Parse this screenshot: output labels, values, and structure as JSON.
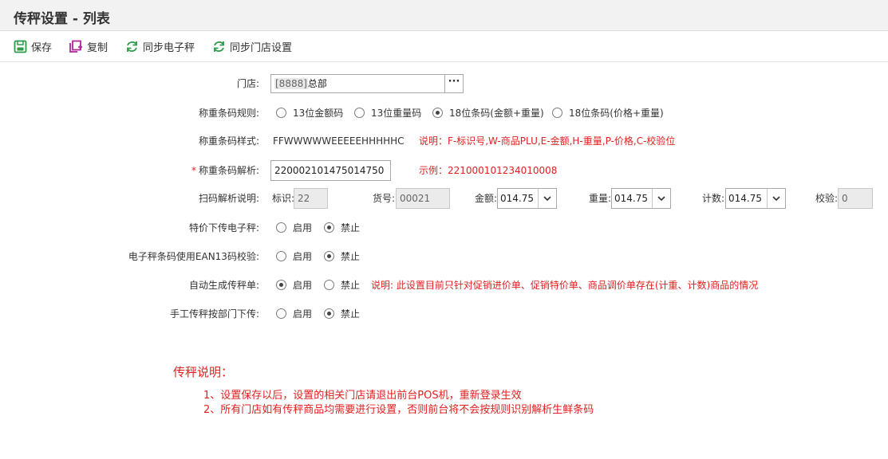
{
  "header": {
    "title": "传秤设置 - 列表"
  },
  "toolbar": {
    "save": "保存",
    "copy": "复制",
    "sync_scale": "同步电子秤",
    "sync_store": "同步门店设置"
  },
  "form": {
    "store": {
      "label": "门店:",
      "prefix": "[8888]",
      "name": "总部"
    },
    "rule": {
      "label": "称重条码规则:",
      "options": [
        "13位金额码",
        "13位重量码",
        "18位条码(金额+重量)",
        "18位条码(价格+重量)"
      ],
      "selected_index": 2
    },
    "style": {
      "label": "称重条码样式:",
      "value": "FFWWWWWEEEEEHHHHHC",
      "note": "说明：F-标识号,W-商品PLU,E-金额,H-重量,P-价格,C-校验位"
    },
    "parse": {
      "required_mark": "*",
      "label": "称重条码解析:",
      "value": "220002101475014750",
      "example": "示例：221000101234010008"
    },
    "scan": {
      "label": "扫码解析说明:",
      "flag_label": "标识:",
      "flag_value": "22",
      "sku_label": "货号:",
      "sku_value": "00021",
      "amount_label": "金额:",
      "amount_value": "014.75",
      "weight_label": "重量:",
      "weight_value": "014.75",
      "count_label": "计数:",
      "count_value": "014.75",
      "check_label": "校验:",
      "check_value": "0"
    },
    "special_price": {
      "label": "特价下传电子秤:",
      "enable": "启用",
      "disable": "禁止",
      "selected": "disable"
    },
    "ean13": {
      "label": "电子秤条码使用EAN13码校验:",
      "enable": "启用",
      "disable": "禁止",
      "selected": "disable"
    },
    "auto_gen": {
      "label": "自动生成传秤单:",
      "enable": "启用",
      "disable": "禁止",
      "selected": "enable",
      "note": "说明: 此设置目前只针对促销进价单、促销特价单、商品调价单存在(计重、计数)商品的情况"
    },
    "manual_dept": {
      "label": "手工传秤按部门下传:",
      "enable": "启用",
      "disable": "禁止",
      "selected": "disable"
    }
  },
  "notes": {
    "title": "传秤说明：",
    "line1": "1、设置保存以后，设置的相关门店请退出前台POS机，重新登录生效",
    "line2": "2、所有门店如有传秤商品均需要进行设置，否则前台将不会按规则识别解析生鲜条码"
  },
  "colors": {
    "note_red": "#e02020",
    "save_icon": "#2e9b4b",
    "copy_icon": "#b0269a",
    "sync_icon": "#2e9b4b"
  }
}
